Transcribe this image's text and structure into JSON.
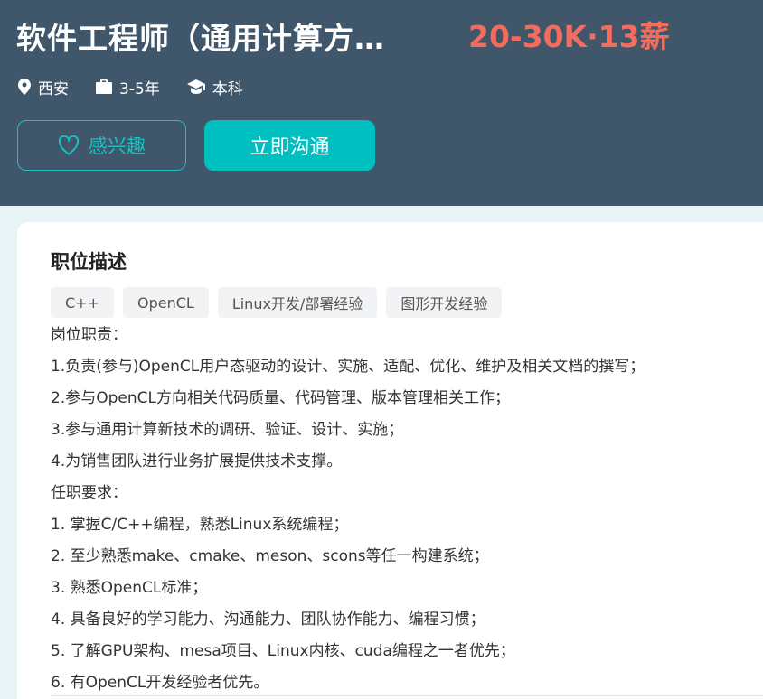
{
  "job": {
    "title": "软件工程师（通用计算方…",
    "salary": "20-30K·13薪",
    "location": "西安",
    "experience": "3-5年",
    "education": "本科"
  },
  "actions": {
    "interest_label": "感兴趣",
    "chat_label": "立即沟通"
  },
  "description": {
    "section_title": "职位描述",
    "tags": [
      "C++",
      "OpenCL",
      "Linux开发/部署经验",
      "图形开发经验"
    ],
    "lines": [
      "岗位职责：",
      "1.负责(参与)OpenCL用户态驱动的设计、实施、适配、优化、维护及相关文档的撰写；",
      "2.参与OpenCL方向相关代码质量、代码管理、版本管理相关工作；",
      "3.参与通用计算新技术的调研、验证、设计、实施；",
      "4.为销售团队进行业务扩展提供技术支撑。",
      "任职要求：",
      "1. 掌握C/C++编程，熟悉Linux系统编程；",
      "2. 至少熟悉make、cmake、meson、scons等任一构建系统；",
      "3. 熟悉OpenCL标准；",
      "4. 具备良好的学习能力、沟通能力、团队协作能力、编程习惯；",
      "5. 了解GPU架构、mesa项目、Linux内核、cuda编程之一者优先；",
      "6. 有OpenCL开发经验者优先。"
    ]
  },
  "colors": {
    "header_bg": "#3f566b",
    "salary": "#f26d5b",
    "accent": "#00bfc0",
    "page_bg": "#e8f3f5"
  },
  "icons": {
    "location": "location-pin-icon",
    "experience": "briefcase-icon",
    "education": "graduation-cap-icon",
    "interest": "heart-icon"
  }
}
